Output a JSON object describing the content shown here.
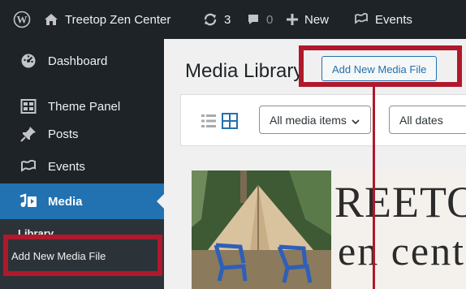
{
  "admin_bar": {
    "site_name": "Treetop Zen Center",
    "updates_count": "3",
    "comments_count": "0",
    "new_label": "New",
    "events_label": "Events"
  },
  "sidebar": {
    "items": [
      {
        "label": "Dashboard",
        "icon": "dashboard-icon"
      },
      {
        "label": "Theme Panel",
        "icon": "theme-panel-icon"
      },
      {
        "label": "Posts",
        "icon": "pin-icon"
      },
      {
        "label": "Events",
        "icon": "events-icon"
      },
      {
        "label": "Media",
        "icon": "media-icon",
        "current": true
      }
    ],
    "submenu": {
      "library_label": "Library",
      "add_new_label": "Add New Media File"
    }
  },
  "main": {
    "page_title": "Media Library",
    "add_new_button": "Add New Media File",
    "filters": {
      "media_items_select": "All media items",
      "dates_select": "All dates"
    },
    "thumbnail_2_text": {
      "line1": "REETO",
      "line2": "en cent"
    }
  },
  "colors": {
    "admin_dark": "#1d2327",
    "accent_blue": "#2271b1",
    "highlight_red": "#b0182b"
  }
}
